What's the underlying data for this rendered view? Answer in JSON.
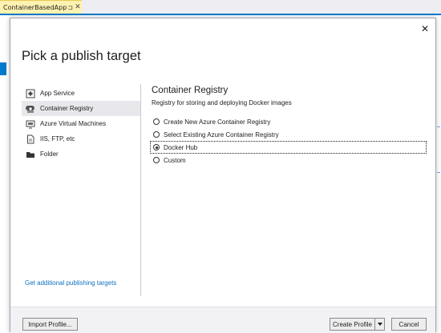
{
  "ide": {
    "tab_title": "ContainerBasedApp",
    "tab_pin_glyph": "⊐",
    "tab_close_glyph": "✕"
  },
  "dialog": {
    "title": "Pick a publish target",
    "close_glyph": "✕",
    "targets": [
      {
        "label": "App Service",
        "icon": "app-service-icon",
        "selected": false
      },
      {
        "label": "Container Registry",
        "icon": "container-registry-icon",
        "selected": true
      },
      {
        "label": "Azure Virtual Machines",
        "icon": "virtual-machine-icon",
        "selected": false
      },
      {
        "label": "IIS, FTP, etc",
        "icon": "document-icon",
        "selected": false
      },
      {
        "label": "Folder",
        "icon": "folder-icon",
        "selected": false
      }
    ],
    "more_targets_link": "Get additional publishing targets",
    "content": {
      "title": "Container Registry",
      "subtitle": "Registry for storing and deploying Docker images",
      "options": [
        {
          "label": "Create New Azure Container Registry",
          "checked": false
        },
        {
          "label": "Select Existing Azure Container Registry",
          "checked": false
        },
        {
          "label": "Docker Hub",
          "checked": true
        },
        {
          "label": "Custom",
          "checked": false
        }
      ]
    },
    "footer": {
      "import_profile": "Import Profile...",
      "create_profile": "Create Profile",
      "cancel": "Cancel"
    }
  }
}
